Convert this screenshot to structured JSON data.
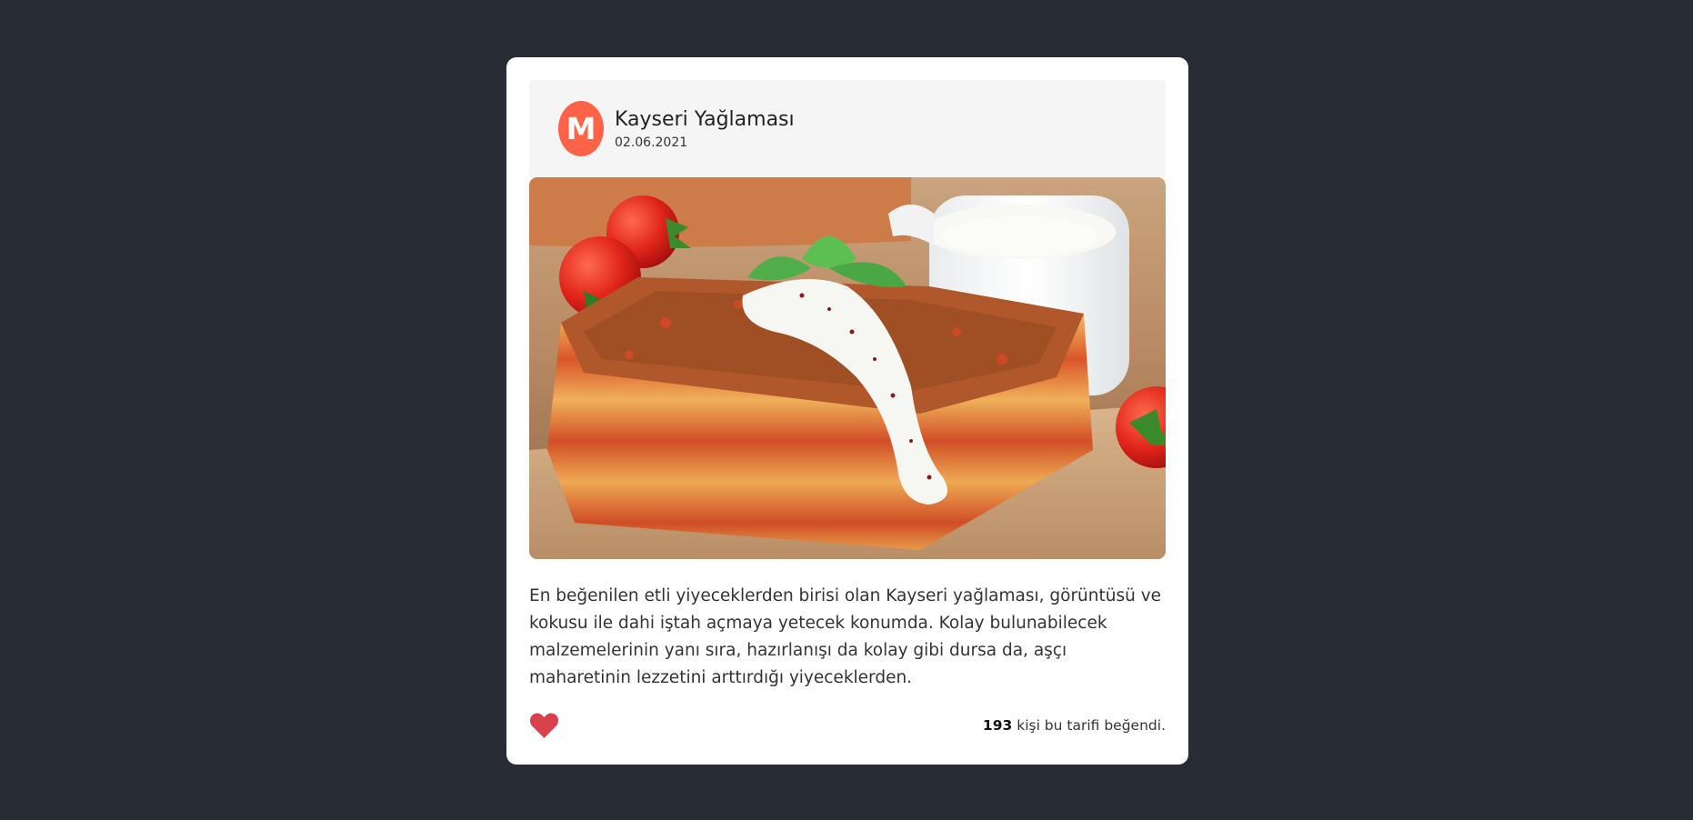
{
  "post": {
    "avatar_letter": "M",
    "avatar_color": "#ff6347",
    "title": "Kayseri Yağlaması",
    "date": "02.06.2021",
    "description": "En beğenilen etli yiyeceklerden birisi olan Kayseri yağlaması, görüntüsü ve kokusu ile dahi iştah açmaya yetecek konumda. Kolay bulunabilecek malzemelerinin yanı sıra, hazırlanışı da kolay gibi dursa da, aşçı maharetinin lezzetini arttırdığı yiyeceklerden.",
    "like_icon": "heart-icon",
    "like_color": "#d9414a",
    "like_count": "193",
    "like_text": "kişi bu tarifi beğendi."
  }
}
